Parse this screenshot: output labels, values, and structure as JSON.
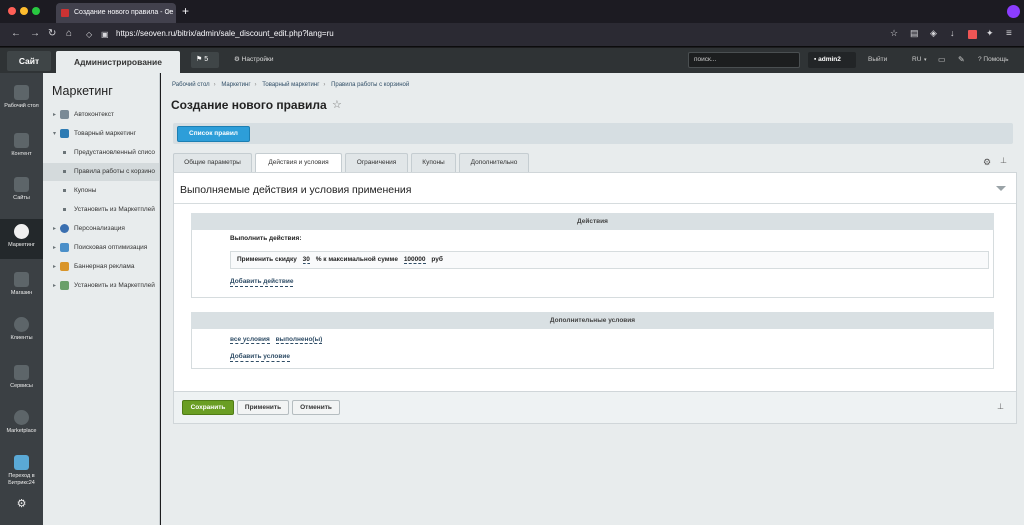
{
  "browser": {
    "tab_title": "Создание нового правила - Се",
    "url": "https://seoven.ru/bitrix/admin/sale_discount_edit.php?lang=ru",
    "new_tab": "+",
    "tab_close": "×"
  },
  "topbar": {
    "site_label": "Сайт",
    "admin_label": "Администрирование",
    "notifications_count": "5",
    "settings_label": "Настройки",
    "search_placeholder": "поиск...",
    "user_name": "admin2",
    "logout_label": "Выйти",
    "lang_label": "RU",
    "help_label": "Помощь"
  },
  "leftnav": [
    {
      "label": "Рабочий стол",
      "icon": "home-icon"
    },
    {
      "label": "Контент",
      "icon": "document-icon"
    },
    {
      "label": "Сайты",
      "icon": "calendar-24-icon"
    },
    {
      "label": "Маркетинг",
      "icon": "target-icon"
    },
    {
      "label": "Магазин",
      "icon": "cart-icon"
    },
    {
      "label": "Клиенты",
      "icon": "clients-icon"
    },
    {
      "label": "Сервисы",
      "icon": "layers-icon"
    },
    {
      "label": "Marketplace",
      "icon": "cloud-download-icon"
    },
    {
      "label": "Переход в Битрикс24",
      "icon": "bitrix24-icon"
    }
  ],
  "submenu": {
    "title": "Маркетинг",
    "items": [
      {
        "label": "Автоконтекст",
        "arrow": "▸"
      },
      {
        "label": "Товарный маркетинг",
        "arrow": "▾"
      },
      {
        "label": "Предустановленный списо"
      },
      {
        "label": "Правила работы с корзино"
      },
      {
        "label": "Купоны"
      },
      {
        "label": "Установить из Маркетплей"
      },
      {
        "label": "Персонализация",
        "arrow": "▸"
      },
      {
        "label": "Поисковая оптимизация",
        "arrow": "▸"
      },
      {
        "label": "Баннерная реклама",
        "arrow": "▸"
      },
      {
        "label": "Установить из Маркетплей",
        "arrow": "▸"
      }
    ]
  },
  "breadcrumb": [
    "Рабочий стол",
    "Маркетинг",
    "Товарный маркетинг",
    "Правила работы с корзиной"
  ],
  "breadcrumb_sep": "›",
  "page_title": "Создание нового правила",
  "list_button": "Список правил",
  "tabs": [
    "Общие параметры",
    "Действия и условия",
    "Ограничения",
    "Купоны",
    "Дополнительно"
  ],
  "active_tab": "Действия и условия",
  "panel_title": "Выполняемые действия и условия применения",
  "actions_section": {
    "header": "Действия",
    "label": "Выполнить действия:",
    "row_prefix": "Применить скидку",
    "discount_value": "30",
    "row_mid": "% к максимальной сумме",
    "max_sum": "100000",
    "currency": "руб",
    "add_link": "Добавить действие"
  },
  "conditions_section": {
    "header": "Дополнительные условия",
    "all_conditions": "все условия",
    "fulfilled": "выполнено(ы)",
    "add_link": "Добавить условие"
  },
  "footer": {
    "save": "Сохранить",
    "apply": "Применить",
    "cancel": "Отменить"
  },
  "colors": {
    "accent_blue": "#2d9ed9",
    "save_green": "#6a9e23"
  }
}
